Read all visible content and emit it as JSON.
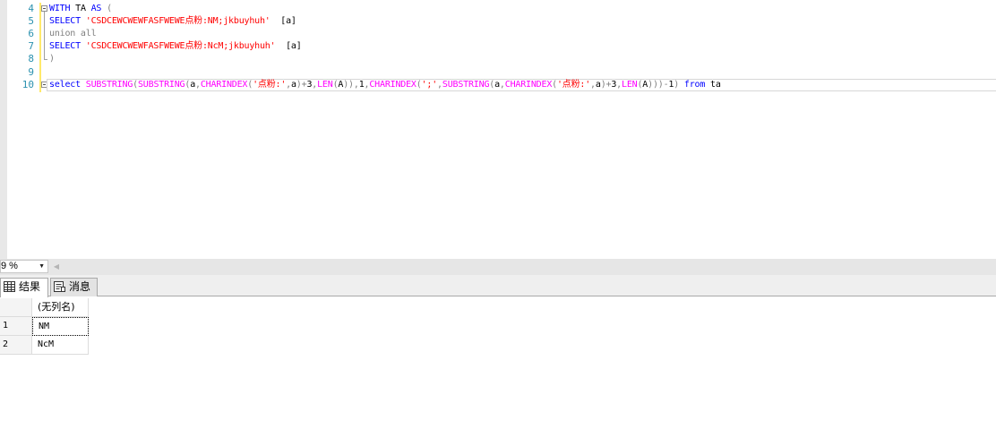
{
  "editor": {
    "line_numbers": [
      "4",
      "5",
      "6",
      "7",
      "8",
      "9",
      "10"
    ],
    "lines": {
      "l4": {
        "kw1": "WITH",
        "name": " TA ",
        "kw2": "AS",
        "op": " ("
      },
      "l5": {
        "kw": "SELECT",
        "str": " 'CSDCEWCWEWFASFWEWE点粉:NM;jkbuyhuh'",
        "alias": "  [a]"
      },
      "l6": {
        "kw": "union all"
      },
      "l7": {
        "kw": "SELECT",
        "str": " 'CSDCEWCWEWFASFWEWE点粉:NcM;jkbuyhuh'",
        "alias": "  [a]"
      },
      "l8": {
        "op": ")"
      },
      "l10": {
        "t1": "select",
        "t2": " SUBSTRING",
        "t3": "(",
        "t4": "SUBSTRING",
        "t5": "(",
        "t6": "a",
        "t7": ",",
        "t8": "CHARINDEX",
        "t9": "(",
        "t10": "'点粉:'",
        "t11": ",",
        "t12": "a",
        "t13": ")+",
        "t14": "3",
        "t15": ",",
        "t16": "LEN",
        "t17": "(",
        "t18": "A",
        "t19": ")),",
        "t20": "1",
        "t21": ",",
        "t22": "CHARINDEX",
        "t23": "(",
        "t24": "';'",
        "t25": ",",
        "t26": "SUBSTRING",
        "t27": "(",
        "t28": "a",
        "t29": ",",
        "t30": "CHARINDEX",
        "t31": "(",
        "t32": "'点粉:'",
        "t33": ",",
        "t34": "a",
        "t35": ")+",
        "t36": "3",
        "t37": ",",
        "t38": "LEN",
        "t39": "(",
        "t40": "A",
        "t41": ")))-",
        "t42": "1",
        "t43": ")",
        "t44": " from",
        "t45": " ta"
      }
    }
  },
  "zoom": {
    "value": "9 %",
    "dropdown_icon": "triangle-down-icon"
  },
  "tabs": [
    {
      "label": "结果",
      "icon": "grid-icon"
    },
    {
      "label": "消息",
      "icon": "message-icon"
    }
  ],
  "results": {
    "column_header": "(无列名)",
    "rows": [
      {
        "num": "1",
        "value": "NM"
      },
      {
        "num": "2",
        "value": "NcM"
      }
    ]
  },
  "colors": {
    "keyword": "#0000ff",
    "function": "#ff00ff",
    "string": "#ff0000",
    "operator": "#808080",
    "line_number": "#2b91af"
  }
}
